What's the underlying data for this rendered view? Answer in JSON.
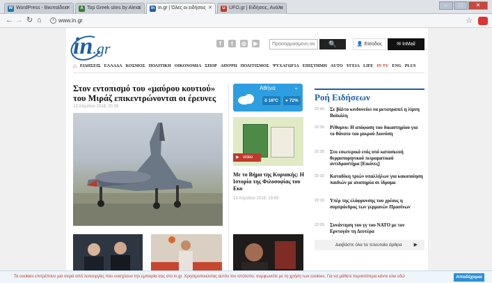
{
  "browser": {
    "tabs": [
      {
        "label": "WordPress - Βικιπαίδεια",
        "favicon": "W",
        "active": false
      },
      {
        "label": "Top Greek sites by Alexa",
        "favicon": "A",
        "active": false
      },
      {
        "label": "in.gr | Όλες οι ειδήσεις",
        "favicon": "in",
        "active": true
      },
      {
        "label": "UFO.gr | Ειδήσεις, Ανάλυ",
        "favicon": "U",
        "active": false
      }
    ],
    "url": "www.in.gr",
    "nav_icons": [
      "back-icon",
      "forward-icon",
      "reload-icon",
      "home-icon",
      "info-icon",
      "star-icon"
    ]
  },
  "site": {
    "logo_main": "in",
    "logo_suffix": ".gr",
    "search_placeholder": "Προσαρμοσμένη ανα",
    "search_button": "🔍",
    "login_label": "Είσοδος",
    "inmail_label": "InMail",
    "nav": [
      "ΕΙΔΗΣΕΙΣ",
      "ΕΛΛΑΔΑ",
      "ΚΟΣΜΟΣ",
      "ΠΟΛΙΤΙΚΗ",
      "ΟΙΚΟΝΟΜΙΑ",
      "ΣΠΟΡ",
      "ΑΠΟΨΗ",
      "ΠΟΛΙΤΙΣΜΟΣ",
      "ΨΥΧΑΓΩΓΙΑ",
      "ΕΠΙΣΤΗΜΗ",
      "AUTO",
      "ΥΓΕΙΑ",
      "LIFE",
      "IN TV",
      "ENG",
      "PLUS"
    ]
  },
  "main_article": {
    "title": "Στον εντοπισμό του «μαύρου κουτιού» του Μιράζ επικεντρώνονται οι έρευνες",
    "date": "13 Απριλίου 2018, 20:39"
  },
  "weather": {
    "city": "Αθήνα",
    "temp": "δ 16ºC",
    "humidity": "● 72%"
  },
  "promo": {
    "video_label": "video",
    "title": "Με το Βήμα της Κυριακής: Η Ιστορία της Φιλοσοφίας του Εκο",
    "date": "13 Απριλίου 2018, 19:49"
  },
  "feed": {
    "title": "Ροή Ειδήσεων",
    "items": [
      {
        "time": "22:49",
        "text": "Σε βάλτο κινδυνεύει να μετατραπεί η λίμνη Βαϊκάλη"
      },
      {
        "time": "22:39",
        "text": "Ρέθυμνο: Η απόφαση του δικαστηρίου για το θάνατο του μικρού Διονύση"
      },
      {
        "time": "22:35",
        "text": "Στο εσωτερικό ενός υπό κατασκευή θερμοπυρηνικού πειραματικού αντιδραστήρα [Εικόνες]"
      },
      {
        "time": "22:33",
        "text": "Καταδίκη τριών υπαλλήλων για κακοποίηση παιδιών με αναπηρία σε ίδρυμα"
      },
      {
        "time": "22:19",
        "text": "Υπέρ της ελάφρυνσης του χρέους η συμπρόεδρος των γερμανών Πρασίνων"
      },
      {
        "time": "22:09",
        "text": "Συνάντηση του γγ του ΝΑΤΟ με τον Ερντογάν τη Δευτέρα"
      }
    ],
    "all_label": "Διαβάστε όλα τα τελευταία άρθρα"
  },
  "cookie": {
    "message": "Τα cookies επιτρέπουν μια σειρά από λειτουργίες που ενισχύουν την εμπειρία σας στο in.gr. Χρησιμοποιώντας αυτόν τον ιστότοπο, συμφωνείτε με τη χρήση των cookies. Για να μάθετε περισσότερα κάντε κλικ εδώ",
    "accept": "Αποδέχομαι"
  }
}
